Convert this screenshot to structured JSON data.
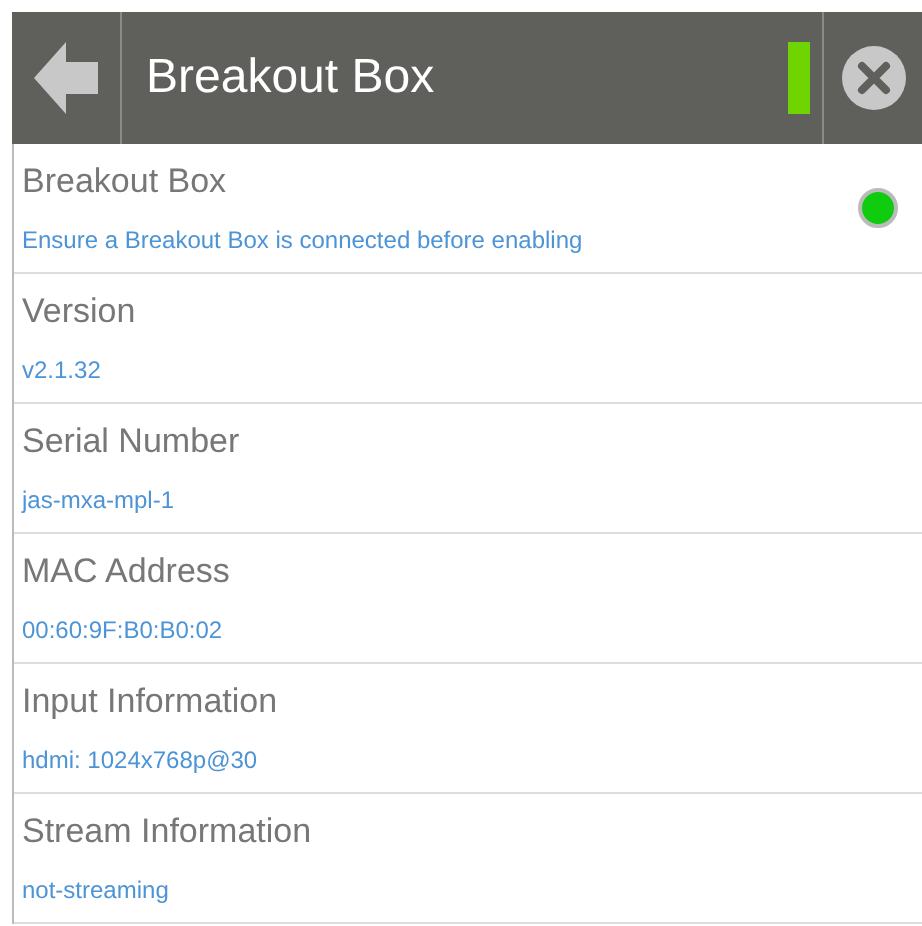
{
  "header": {
    "title": "Breakout Box",
    "indicator_on": true
  },
  "rows": [
    {
      "kind": "toggle",
      "label": "Breakout Box",
      "value": "Ensure a Breakout Box is connected before enabling",
      "enabled": true
    },
    {
      "kind": "info",
      "label": "Version",
      "value": "v2.1.32"
    },
    {
      "kind": "info",
      "label": "Serial Number",
      "value": "jas-mxa-mpl-1"
    },
    {
      "kind": "info",
      "label": "MAC Address",
      "value": "00:60:9F:B0:B0:02"
    },
    {
      "kind": "info",
      "label": "Input Information",
      "value": "hdmi: 1024x768p@30"
    },
    {
      "kind": "info",
      "label": "Stream Information",
      "value": "not-streaming"
    }
  ]
}
